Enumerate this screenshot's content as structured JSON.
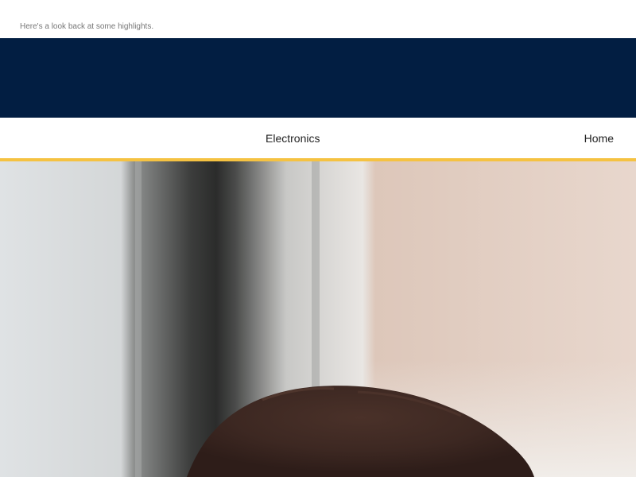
{
  "preheader": {
    "text": "Here's a look back at some highlights."
  },
  "banner": {
    "color": "#021e42"
  },
  "nav": {
    "accent_color": "#f5c242",
    "items": [
      {
        "label": "Electronics"
      },
      {
        "label": "Home"
      }
    ]
  },
  "hero": {
    "image_name": "hero-photo-child-hair"
  }
}
